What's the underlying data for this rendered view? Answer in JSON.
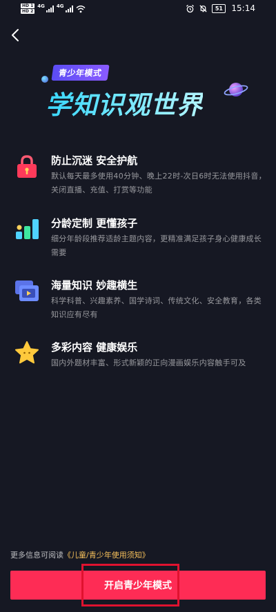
{
  "status_bar": {
    "sim1": "HD 1",
    "sim2": "HD 2",
    "network1": "4G",
    "network2": "4G",
    "battery": "51",
    "time": "15:14",
    "icons": [
      "signal-icon",
      "wifi-icon",
      "alarm-icon",
      "mute-icon",
      "battery-icon"
    ]
  },
  "header": {
    "back_icon": "chevron-left-icon"
  },
  "hero": {
    "badge": "青少年模式",
    "title": "学知识观世界",
    "decoration_icon": "saturn-icon"
  },
  "features": [
    {
      "icon": "lock-icon",
      "title": "防止沉迷 安全护航",
      "desc": "默认每天最多使用40分钟、晚上22时-次日6时无法使用抖音，关闭直播、充值、打赏等功能"
    },
    {
      "icon": "bar-chart-icon",
      "title": "分龄定制 更懂孩子",
      "desc": "细分年龄段推荐适龄主题内容，更精准满足孩子身心健康成长需要"
    },
    {
      "icon": "video-folder-icon",
      "title": "海量知识 妙趣横生",
      "desc": "科学科普、兴趣素养、国学诗词、传统文化、安全教育，各类知识应有尽有"
    },
    {
      "icon": "star-icon",
      "title": "多彩内容 健康娱乐",
      "desc": "国内外题材丰富、形式新颖的正向漫画娱乐内容触手可及"
    }
  ],
  "footer": {
    "notice_prefix": "更多信息可阅读",
    "notice_link": "《儿童/青少年使用须知》",
    "start_button": "开启青少年模式"
  },
  "colors": {
    "background": "#161823",
    "accent": "#fe2c55",
    "link": "#f7c15b",
    "highlight": "#e0122f"
  }
}
